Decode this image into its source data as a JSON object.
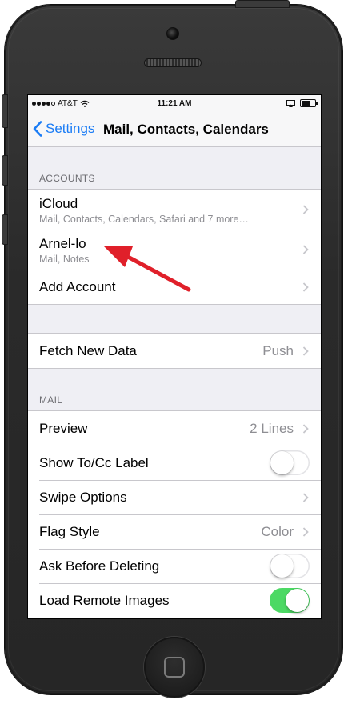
{
  "status_bar": {
    "carrier": "AT&T",
    "time": "11:21 AM"
  },
  "nav": {
    "back_label": "Settings",
    "title": "Mail, Contacts, Calendars"
  },
  "accounts": {
    "header": "ACCOUNTS",
    "items": [
      {
        "title": "iCloud",
        "subtitle": "Mail, Contacts, Calendars, Safari and 7 more…"
      },
      {
        "title": "Arnel-lo",
        "subtitle": "Mail, Notes"
      },
      {
        "title": "Add Account"
      }
    ]
  },
  "fetch": {
    "title": "Fetch New Data",
    "value": "Push"
  },
  "mail": {
    "header": "MAIL",
    "items": [
      {
        "title": "Preview",
        "value": "2 Lines"
      },
      {
        "title": "Show To/Cc Label",
        "toggle_on": false
      },
      {
        "title": "Swipe Options"
      },
      {
        "title": "Flag Style",
        "value": "Color"
      },
      {
        "title": "Ask Before Deleting",
        "toggle_on": false
      },
      {
        "title": "Load Remote Images",
        "toggle_on": true
      }
    ]
  },
  "colors": {
    "accent": "#1a7cf5",
    "toggle_on": "#4cd964",
    "annotation_arrow": "#e0202a"
  },
  "icons": {
    "back": "chevron-left-icon",
    "disclosure": "chevron-right-icon",
    "wifi": "wifi-icon",
    "airplay": "airplay-icon",
    "battery": "battery-icon",
    "annotation": "red-arrow-icon"
  }
}
